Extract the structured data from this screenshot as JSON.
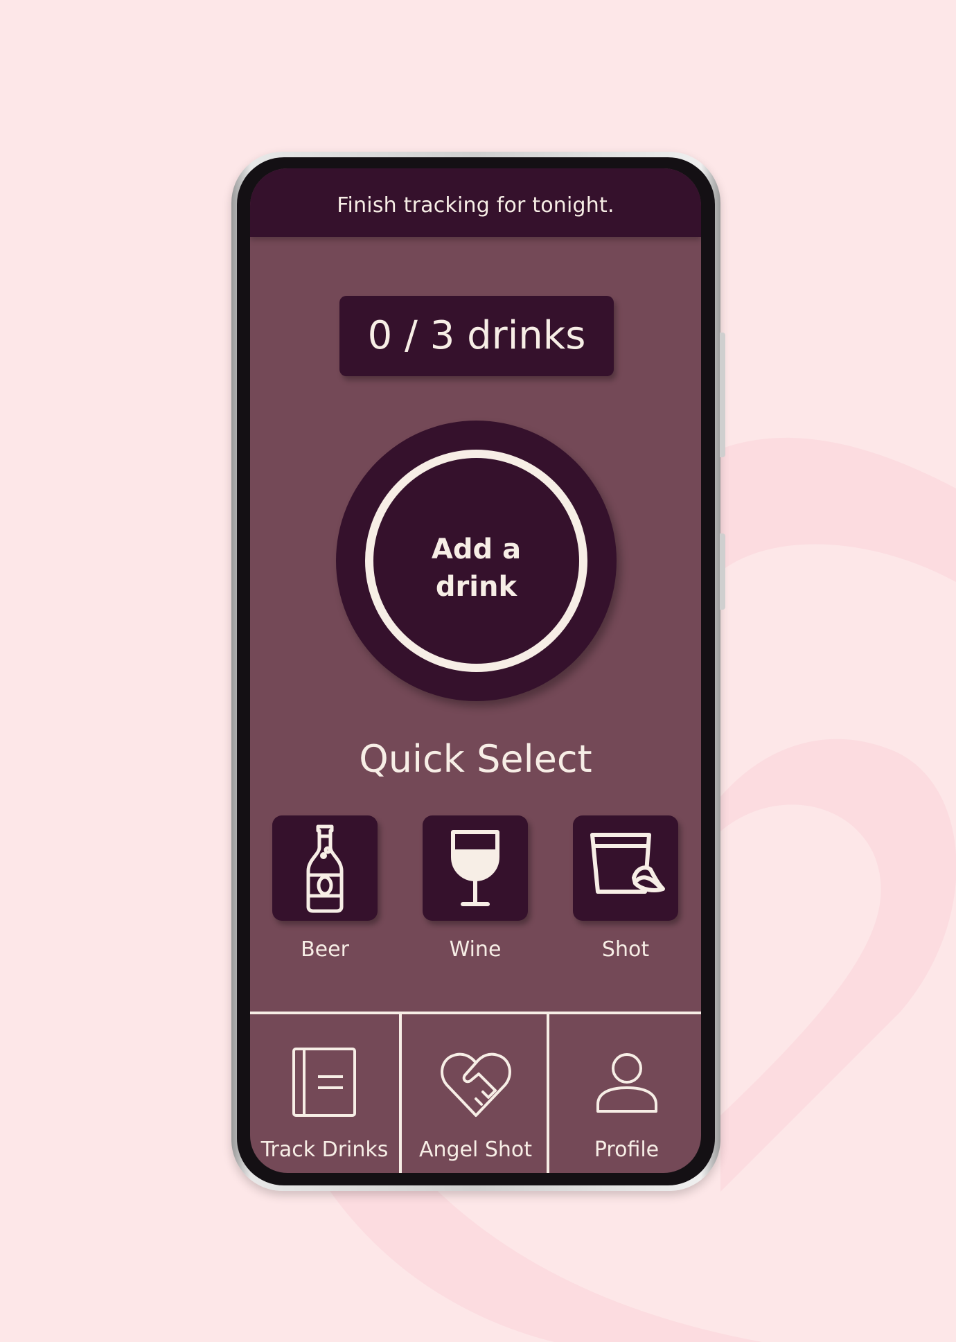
{
  "topbar": {
    "text": "Finish tracking for tonight."
  },
  "counter": {
    "text": "0 / 3 drinks"
  },
  "add_drink": {
    "line1": "Add a",
    "line2": "drink"
  },
  "quick_select": {
    "title": "Quick Select",
    "items": [
      {
        "label": "Beer",
        "icon": "beer-bottle-icon"
      },
      {
        "label": "Wine",
        "icon": "wine-glass-icon"
      },
      {
        "label": "Shot",
        "icon": "shot-glass-icon"
      }
    ]
  },
  "nav": {
    "items": [
      {
        "label": "Track Drinks",
        "icon": "book-icon"
      },
      {
        "label": "Angel Shot",
        "icon": "heart-handshake-icon"
      },
      {
        "label": "Profile",
        "icon": "user-icon"
      }
    ]
  },
  "colors": {
    "background": "#fde7e8",
    "screen": "#744957",
    "dark_plum": "#35112c",
    "text": "#f7eee6"
  }
}
